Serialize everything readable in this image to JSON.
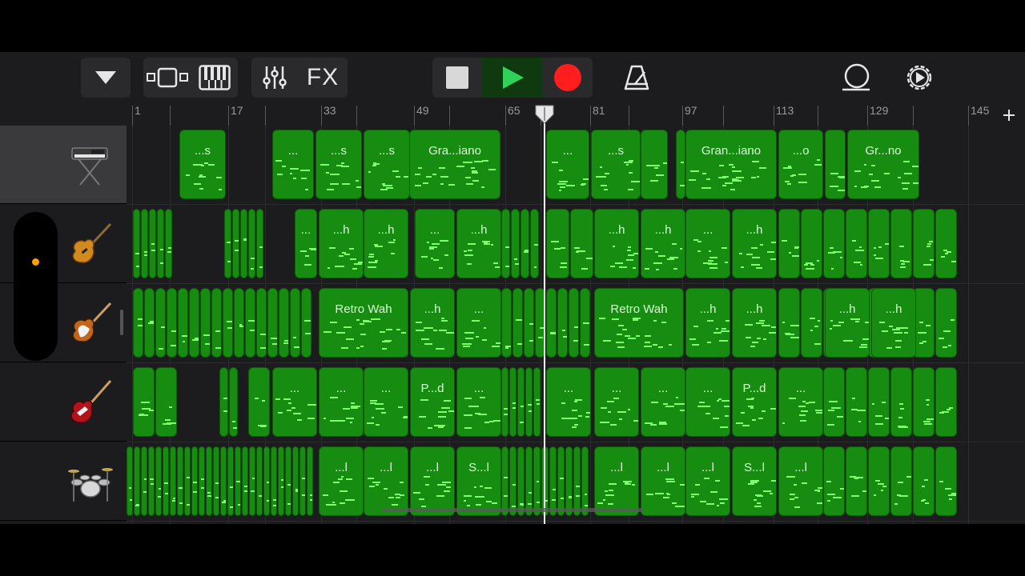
{
  "toolbar": {
    "fx_label": "FX",
    "colors": {
      "play": "#30d158",
      "record": "#ff1e1e",
      "stop": "#d8d8d8"
    }
  },
  "ruler": {
    "bar_labels": [
      "1",
      "17",
      "33",
      "49",
      "65",
      "81",
      "97",
      "113",
      "129",
      "145"
    ]
  },
  "tracks": [
    {
      "instrument": "keyboard-icon",
      "selected": true
    },
    {
      "instrument": "electric-guitar-icon",
      "selected": false
    },
    {
      "instrument": "electric-guitar-icon",
      "selected": false
    },
    {
      "instrument": "bass-guitar-icon",
      "selected": false
    },
    {
      "instrument": "drum-kit-icon",
      "selected": false
    }
  ],
  "regions": [
    [
      {
        "label": "...s"
      },
      {
        "label": "..."
      },
      {
        "label": "...s"
      },
      {
        "label": "...s"
      },
      {
        "label": "Gra...iano"
      },
      {
        "label": "..."
      },
      {
        "label": "...s"
      },
      {
        "label": ""
      },
      {
        "label": ""
      },
      {
        "label": "Gran...iano"
      },
      {
        "label": "...o"
      },
      {
        "label": ""
      },
      {
        "label": "Gr...no"
      }
    ],
    [
      {
        "label": "..."
      },
      {
        "label": "...h"
      },
      {
        "label": "...h"
      },
      {
        "label": "..."
      },
      {
        "label": "...h"
      },
      {
        "label": "...h"
      },
      {
        "label": "...h"
      },
      {
        "label": "..."
      },
      {
        "label": "...h"
      }
    ],
    [
      {
        "label": "Retro Wah"
      },
      {
        "label": "...h"
      },
      {
        "label": "..."
      },
      {
        "label": "Retro Wah"
      },
      {
        "label": "...h"
      },
      {
        "label": "...h"
      },
      {
        "label": "...h"
      },
      {
        "label": "...h"
      }
    ],
    [
      {
        "label": "..."
      },
      {
        "label": "..."
      },
      {
        "label": "..."
      },
      {
        "label": "P...d"
      },
      {
        "label": "..."
      },
      {
        "label": "..."
      },
      {
        "label": "..."
      },
      {
        "label": "..."
      },
      {
        "label": "..."
      },
      {
        "label": "P...d"
      },
      {
        "label": "..."
      }
    ],
    [
      {
        "label": "...l"
      },
      {
        "label": "...l"
      },
      {
        "label": "...l"
      },
      {
        "label": "S...l"
      },
      {
        "label": "...l"
      },
      {
        "label": "...l"
      },
      {
        "label": "...l"
      },
      {
        "label": "S...l"
      },
      {
        "label": "...l"
      }
    ]
  ]
}
